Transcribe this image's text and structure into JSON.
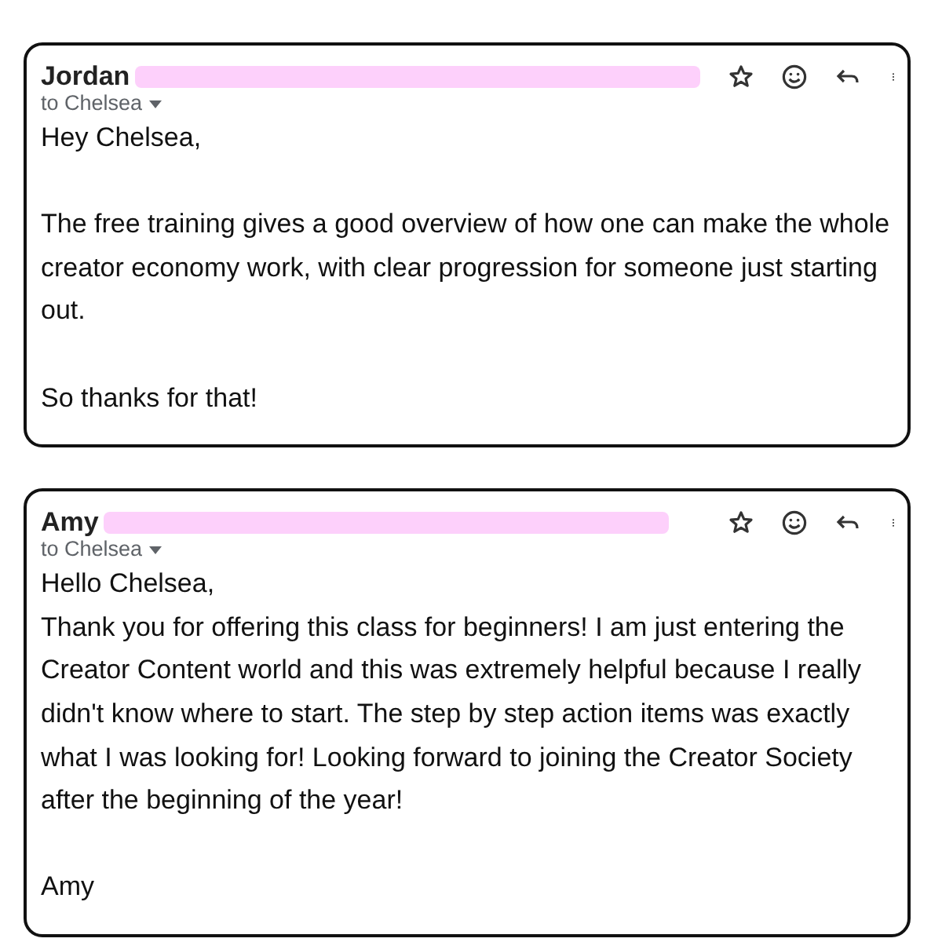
{
  "emails": [
    {
      "sender": "Jordan",
      "redacted": true,
      "recipient": "to Chelsea",
      "paragraphs": [
        {
          "lines": [
            "Hey Chelsea,"
          ]
        },
        {
          "lines": [
            "The free training gives a good overview of how one can make the whole creator economy work, with clear progression for someone just starting out."
          ]
        },
        {
          "lines": [
            "So thanks for that!"
          ]
        }
      ]
    },
    {
      "sender": "Amy",
      "redacted": true,
      "recipient": "to Chelsea",
      "paragraphs": [
        {
          "lines": [
            "Hello Chelsea,",
            "Thank you for offering this class for beginners! I am just entering the Creator Content world and this was extremely helpful because I really didn't know where to start.  The step by step action items was exactly what I was looking for!  Looking forward to joining the Creator Society after the beginning of the year!"
          ]
        },
        {
          "lines": [
            "Amy"
          ]
        }
      ]
    }
  ]
}
